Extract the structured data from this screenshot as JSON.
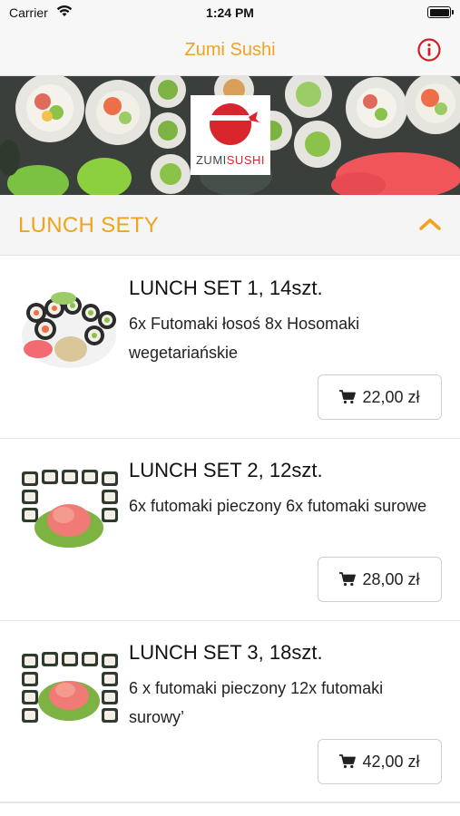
{
  "status_bar": {
    "carrier": "Carrier",
    "time": "1:24 PM"
  },
  "nav": {
    "title": "Zumi Sushi",
    "info_icon": "info-icon"
  },
  "hero": {
    "logo_text_a": "ZUMI",
    "logo_text_b": "SUSHI",
    "logo_color": "#d8262c"
  },
  "section": {
    "title": "LUNCH SETY",
    "expanded": true,
    "chevron_icon": "chevron-up-icon"
  },
  "accent_color": "#f0a31c",
  "items": [
    {
      "name": "LUNCH SET 1, 14szt.",
      "description": "6x Futomaki łosoś 8x Hosomaki wegetariańskie",
      "price": "22,00 zł",
      "cart_icon": "cart-icon"
    },
    {
      "name": "LUNCH SET 2, 12szt.",
      "description": "6x futomaki pieczony 6x futomaki surowe",
      "price": "28,00 zł",
      "cart_icon": "cart-icon"
    },
    {
      "name": "LUNCH SET 3, 18szt.",
      "description": "6 x futomaki pieczony 12x futomaki surowy’",
      "price": "42,00 zł",
      "cart_icon": "cart-icon"
    }
  ]
}
